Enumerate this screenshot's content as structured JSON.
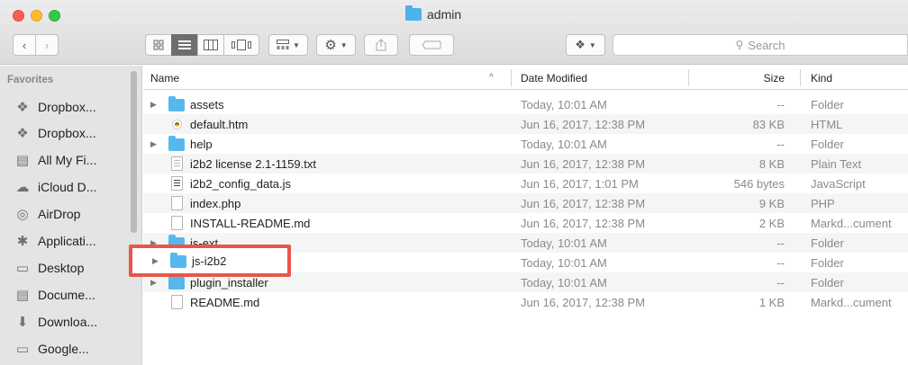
{
  "window": {
    "title": "admin"
  },
  "toolbar": {
    "back_glyph": "‹",
    "forward_glyph": "›",
    "search_placeholder": "Search",
    "icons": [
      "back-arrow-icon",
      "forward-arrow-icon",
      "icon-view-icon",
      "list-view-icon",
      "column-view-icon",
      "cover-flow-icon",
      "arrange-icon",
      "gear-icon",
      "share-icon",
      "tag-icon",
      "dropbox-icon",
      "search-icon"
    ]
  },
  "sidebar": {
    "heading": "Favorites",
    "items": [
      {
        "label": "Dropbox...",
        "icon": "dropbox-icon"
      },
      {
        "label": "Dropbox...",
        "icon": "dropbox-icon"
      },
      {
        "label": "All My Fi...",
        "icon": "all-files-icon"
      },
      {
        "label": "iCloud D...",
        "icon": "cloud-icon"
      },
      {
        "label": "AirDrop",
        "icon": "airdrop-icon"
      },
      {
        "label": "Applicati...",
        "icon": "applications-icon"
      },
      {
        "label": "Desktop",
        "icon": "desktop-icon"
      },
      {
        "label": "Docume...",
        "icon": "documents-icon"
      },
      {
        "label": "Downloa...",
        "icon": "downloads-icon"
      },
      {
        "label": "Google...",
        "icon": "folder-icon"
      }
    ]
  },
  "columns": {
    "name": "Name",
    "sort_glyph": "^",
    "date": "Date Modified",
    "size": "Size",
    "kind": "Kind"
  },
  "files": [
    {
      "name": "assets",
      "date": "Today, 10:01 AM",
      "size": "--",
      "kind": "Folder",
      "type": "folder"
    },
    {
      "name": "default.htm",
      "date": "Jun 16, 2017, 12:38 PM",
      "size": "83 KB",
      "kind": "HTML",
      "type": "html"
    },
    {
      "name": "help",
      "date": "Today, 10:01 AM",
      "size": "--",
      "kind": "Folder",
      "type": "folder"
    },
    {
      "name": "i2b2 license 2.1-1159.txt",
      "date": "Jun 16, 2017, 12:38 PM",
      "size": "8 KB",
      "kind": "Plain Text",
      "type": "txt"
    },
    {
      "name": "i2b2_config_data.js",
      "date": "Jun 16, 2017, 1:01 PM",
      "size": "546 bytes",
      "kind": "JavaScript",
      "type": "js"
    },
    {
      "name": "index.php",
      "date": "Jun 16, 2017, 12:38 PM",
      "size": "9 KB",
      "kind": "PHP",
      "type": "doc"
    },
    {
      "name": "INSTALL-README.md",
      "date": "Jun 16, 2017, 12:38 PM",
      "size": "2 KB",
      "kind": "Markd...cument",
      "type": "doc"
    },
    {
      "name": "js-ext",
      "date": "Today, 10:01 AM",
      "size": "--",
      "kind": "Folder",
      "type": "folder"
    },
    {
      "name": "js-i2b2",
      "date": "Today, 10:01 AM",
      "size": "--",
      "kind": "Folder",
      "type": "folder"
    },
    {
      "name": "plugin_installer",
      "date": "Today, 10:01 AM",
      "size": "--",
      "kind": "Folder",
      "type": "folder"
    },
    {
      "name": "README.md",
      "date": "Jun 16, 2017, 12:38 PM",
      "size": "1 KB",
      "kind": "Markd...cument",
      "type": "doc"
    }
  ],
  "annotation": {
    "highlighted_item": "js-i2b2",
    "color": "#e8564a"
  }
}
